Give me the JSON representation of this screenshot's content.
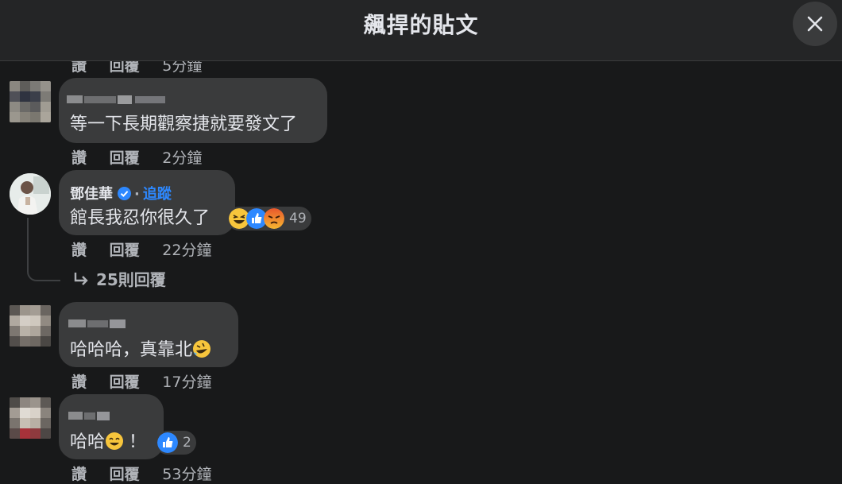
{
  "header": {
    "title": "飆捍的貼文"
  },
  "actions": {
    "like": "讚",
    "reply": "回覆"
  },
  "comments": [
    {
      "time": "5分鐘"
    },
    {
      "text": "等一下長期觀察捷就要發文了",
      "time": "2分鐘"
    },
    {
      "author": "鄧佳華",
      "follow": "追蹤",
      "text": "館長我忍你很久了",
      "reaction_count": "49",
      "time": "22分鐘",
      "replies": "25則回覆"
    },
    {
      "text": "哈哈哈，真靠北",
      "time": "17分鐘"
    },
    {
      "text": "哈哈",
      "suffix": "！",
      "reaction_count": "2",
      "time": "53分鐘"
    }
  ],
  "colors": {
    "accent": "#2d88ff",
    "bubble": "#3a3b3c",
    "background": "#18191a"
  }
}
